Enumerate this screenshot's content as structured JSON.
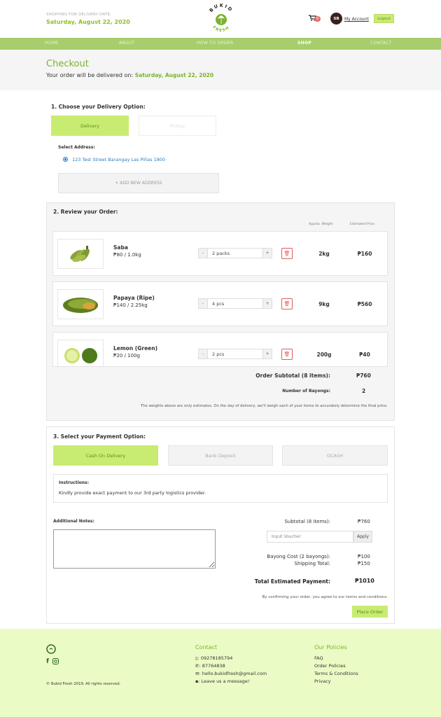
{
  "header": {
    "date_label": "SHOPPING FOR DELIVERY DATE:",
    "date_value": "Saturday, August 22, 2020",
    "logo_top": "BUKID",
    "logo_bottom": "FRESH",
    "cart_count": "0",
    "avatar_initials": "SB",
    "account_label": "My Account",
    "logout_label": "Logout"
  },
  "nav": {
    "items": [
      "HOME",
      "ABOUT",
      "HOW TO ORDER",
      "SHOP",
      "CONTACT"
    ],
    "active": "SHOP"
  },
  "page": {
    "title": "Checkout",
    "deliver_prefix": "Your order will be delivered on:",
    "deliver_date": "Saturday, August 22, 2020"
  },
  "delivery": {
    "heading": "1. Choose your Delivery Option:",
    "options": [
      "Delivery",
      "Pickup"
    ],
    "selected": "Delivery",
    "select_address_label": "Select Address:",
    "address": "123 Test Street Barangay Las Piñas 1800",
    "add_address_label": "+ ADD NEW ADDRESS"
  },
  "review": {
    "heading": "2. Review your Order:",
    "col_weight": "Approx. Weight",
    "col_price": "Estimated Price",
    "items": [
      {
        "name": "Saba",
        "unit_price": "₱80 / 1.0kg",
        "qty": "2 packs",
        "weight": "2kg",
        "price": "₱160"
      },
      {
        "name": "Papaya (Ripe)",
        "unit_price": "₱140 / 2.25kg",
        "qty": "4 pcs",
        "weight": "9kg",
        "price": "₱560"
      },
      {
        "name": "Lemon (Green)",
        "unit_price": "₱20 / 100g",
        "qty": "2 pcs",
        "weight": "200g",
        "price": "₱40"
      }
    ],
    "subtotal_label": "Order Subtotal (8 items):",
    "subtotal_value": "₱760",
    "bayongs_label": "Number of Bayongs:",
    "bayongs_value": "2",
    "disclaimer": "The weights above are only estimates. On the day of delivery, we'll weigh each of your items to accurately determine the final price."
  },
  "payment": {
    "heading": "3. Select your Payment Option:",
    "options": [
      "Cash On Delivery",
      "Bank Deposit",
      "GCASH"
    ],
    "selected": "Cash On Delivery",
    "instructions_title": "Instructions:",
    "instructions_text": "Kindly provide exact payment to our 3rd party logistics provider.",
    "notes_label": "Additional Notes:",
    "subtotal_label": "Subtotal (8 items):",
    "subtotal_value": "₱760",
    "voucher_placeholder": "Input Voucher",
    "apply_label": "Apply",
    "bayong_cost_label": "Bayong Cost (2 bayongs):",
    "bayong_cost_value": "₱100",
    "shipping_label": "Shipping Total:",
    "shipping_value": "₱150",
    "total_label": "Total Estimated Payment:",
    "total_value": "₱1010",
    "agree_text": "By confirming your order, you agree to our terms and conditions.",
    "place_order_label": "Place Order"
  },
  "footer": {
    "copyright": "© Bukid Fresh 2019. All rights reserved.",
    "contact_heading": "Contact",
    "phone1": ": 09278185794",
    "phone2": ": 87764838",
    "email": ": hello.bukidfresh@gmail.com",
    "message": ": Leave us a message!",
    "policies_heading": "Our Policies",
    "policies": [
      "FAQ",
      "Order Policies",
      "Terms & Conditions",
      "Privacy"
    ]
  },
  "colors": {
    "accent": "#7bb32e",
    "nav_bg": "#a8cd6c",
    "button_green": "#c8ec71",
    "footer_bg": "#ebfbc5",
    "trash_red": "#e05a5a"
  }
}
